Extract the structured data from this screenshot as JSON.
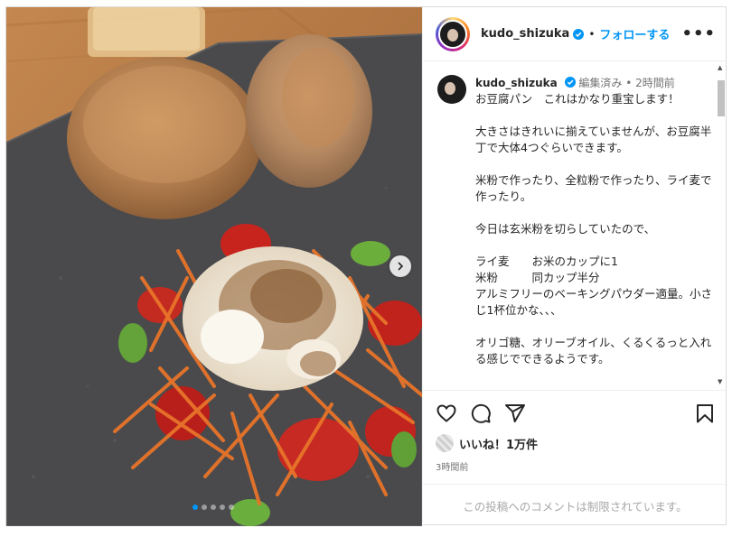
{
  "post": {
    "username": "kudo_shizuka",
    "follow_label": "フォローする",
    "more_label": "•••",
    "separator": "•",
    "caption_meta": {
      "username": "kudo_shizuka",
      "edited": "編集済み",
      "separator": "•",
      "time": "2時間前"
    },
    "caption_text": "お豆腐パン　これはかなり重宝します！\n\n大きさはきれいに揃えていませんが、お豆腐半丁で大体4つぐらいできます。\n\n米粉で作ったり、全粒粉で作ったり、ライ麦で作ったり。\n\n今日は玄米粉を切らしていたので、\n\nライ麦　　お米のカップに1\n米粉　　　同カップ半分\nアルミフリーのベーキングパウダー適量。小さじ1杯位かな、、、\n\nオリゴ糖、オリーブオイル、くるくるっと入れる感じでできるようです。",
    "likes_text": "いいね！1万件",
    "time_ago": "3時間前",
    "comments_disabled": "この投稿へのコメントは制限されています。"
  },
  "carousel": {
    "slide_count": 5,
    "active_index": 0
  },
  "icons": {
    "heart": "heart-icon",
    "comment": "comment-icon",
    "share": "share-icon",
    "save": "bookmark-icon",
    "verified": "verified-badge-icon",
    "next": "chevron-right-icon"
  },
  "colors": {
    "accent": "#0095f6",
    "text": "#262626",
    "muted": "#737373",
    "border": "#dbdbdb"
  }
}
